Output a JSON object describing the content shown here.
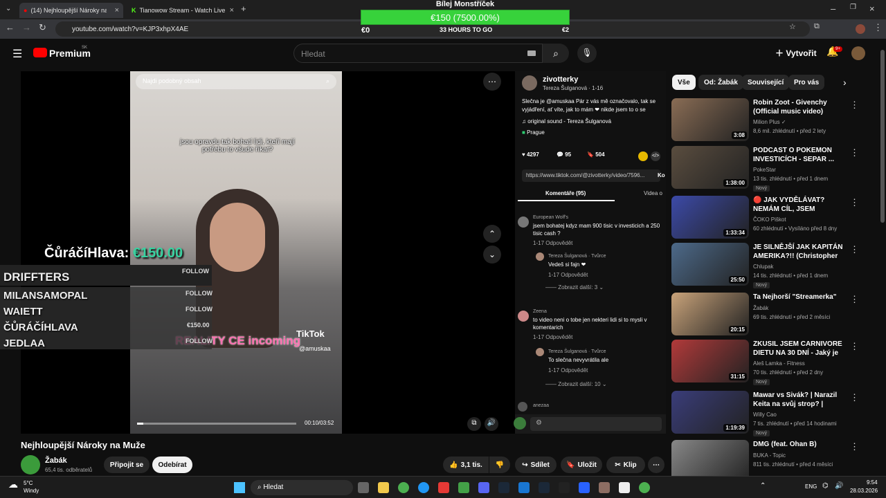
{
  "browser": {
    "tabs": [
      {
        "label": "(14) Nejhloupější Nároky na Mu..."
      },
      {
        "label": "Tianowow Stream - Watch Live"
      }
    ],
    "url": "youtube.com/watch?v=KJP3xhpX4AE"
  },
  "goal": {
    "title": "Bílej Monstříček",
    "amount": "€150 (7500.00%)",
    "left": "€0",
    "middle": "33 HOURS TO GO",
    "right": "€2",
    "accent": "#37d23b"
  },
  "yt": {
    "logo": "Premium",
    "region": "SK",
    "search_placeholder": "Hledat",
    "create": "Vytvořit",
    "notif_count": "9+"
  },
  "overlay": {
    "donor_name": "ČůráčíHlava:",
    "donor_amount": "€150.00",
    "rows": [
      {
        "name": "DRIFFTERS",
        "tag": "FOLLOW"
      },
      {
        "name": "MILANSAMOPAL",
        "tag": "FOLLOW"
      },
      {
        "name": "WAIETT",
        "tag": "FOLLOW"
      },
      {
        "name": "ČŮRÁČÍHLAVA",
        "tag": "€150.00"
      },
      {
        "name": "JEDLAA",
        "tag": "FOLLOW"
      }
    ]
  },
  "video": {
    "search_hint": "Najdi podobný obsah",
    "caption": "jsou opravdu tak bohatí lidi, kteří mají potřebu to všude říkat?",
    "sticker": "REALITY CE incoming",
    "brand": "TikTok",
    "handle": "@amuskaa",
    "time": "00:10/03:52"
  },
  "tiktok": {
    "user": "zivotterky",
    "sub": "Tereza Šulganová · 1-16",
    "desc": "Slečna je @amuskaa Pár z vás mě označovalo, tak se vyjádření, ať víte, jak to mám ❤ nikde jsem to o se",
    "sound": "original sound - Tereza Šulganová",
    "place": "Prague",
    "likes": "4297",
    "comments": "95",
    "saves": "504",
    "link": "https://www.tiktok.com/@zivotterky/video/7596...",
    "copy": "Ko",
    "tab1": "Komentáře (95)",
    "tab2": "Videa o",
    "c1_name": "European Wolf's",
    "c1_text": "jsem bohatej kdyz mam 900 tisic v investicich a 250 tisic cash ?",
    "c1_meta": "1-17 Odpovědět",
    "r1_name": "Tereza Šulganová · Tvůrce",
    "r1_text": "Vedeš si fajn ❤",
    "r1_meta": "1-17 Odpovědět",
    "more1": "Zobrazit další: 3",
    "c2_name": "Zeena",
    "c2_text": "to video neni o tobe jen nekteri lidi si to mysli v komentarich",
    "c2_meta": "1-17 Odpovědět",
    "r2_name": "Tereza Šulganová · Tvůrce",
    "r2_text": "To slečna nevyvrátila ale",
    "r2_meta": "1-17 Odpovědět",
    "more2": "Zobrazit další: 10",
    "c3_name": "anezaa"
  },
  "main": {
    "title": "Nejhloupější Nároky na Muže",
    "channel": "Žabák",
    "subs": "65,4 tis. odběratelů",
    "join": "Připojit se",
    "subscribe": "Odebírat",
    "likes": "3,1 tis.",
    "share": "Sdílet",
    "save": "Uložit",
    "clip": "Klip"
  },
  "chips": [
    "Vše",
    "Od: Žabák",
    "Související",
    "Pro vás"
  ],
  "recs": [
    {
      "title": "Robin Zoot - Givenchy (Official music video)",
      "channel": "Milion Plus ✓",
      "meta": "8,6 mil. zhlédnutí • před 2 lety",
      "dur": "3:08",
      "badge": "",
      "color": "#8a6d55"
    },
    {
      "title": "PODCAST O POKEMON INVESTICÍCH - SEPAR ...",
      "channel": "PokeStar",
      "meta": "13 tis. zhlédnutí • před 1 dnem",
      "dur": "1:38:00",
      "badge": "Nový",
      "color": "#5a4d3f"
    },
    {
      "title": "🔴 JAK VYDĚLÁVAT? NEMÁM CÍL, JSEM ZTRACENÝ... 😢 | ...",
      "channel": "ČOKO Piškot",
      "meta": "60 zhlédnutí • Vysíláno před 8 dny",
      "dur": "1:33:34",
      "badge": "",
      "color": "#3c4aa8"
    },
    {
      "title": "JE SILNĚJŠÍ JAK KAPITÁN AMERIKA?!! (Christopher Dorn...",
      "channel": "Chlupak",
      "meta": "14 tis. zhlédnutí • před 1 dnem",
      "dur": "25:50",
      "badge": "Nový",
      "color": "#4d6a8a"
    },
    {
      "title": "Ta Nejhorší \"Streamerka\"",
      "channel": "Žabák",
      "meta": "69 tis. zhlédnutí • před 2 měsíci",
      "dur": "20:15",
      "badge": "",
      "color": "#c9a37a"
    },
    {
      "title": "ZKUSIL JSEM CARNIVORE DIETU NA 30 DNÍ - Jaký je můj...",
      "channel": "Aleš Lamka - Fitness",
      "meta": "70 tis. zhlédnutí • před 2 dny",
      "dur": "31:15",
      "badge": "Nový",
      "color": "#b23a3a"
    },
    {
      "title": "Mawar vs Sivák? | Narazil Keita na svůj strop? | POPOKEC",
      "channel": "Willy Cao",
      "meta": "7 tis. zhlédnutí • před 14 hodinami",
      "dur": "1:19:39",
      "badge": "Nový",
      "color": "#3a3d7a"
    },
    {
      "title": "DMG (feat. Ohan B)",
      "channel": "BUKA - Topic",
      "meta": "811 tis. zhlédnutí • před 4 měsíci",
      "dur": "",
      "badge": "",
      "color": "#888888"
    }
  ],
  "taskbar": {
    "temp": "5°C",
    "weather": "Windy",
    "search": "Hledat",
    "lang": "ENG",
    "time": "9:54",
    "date": "28.03.2026"
  }
}
